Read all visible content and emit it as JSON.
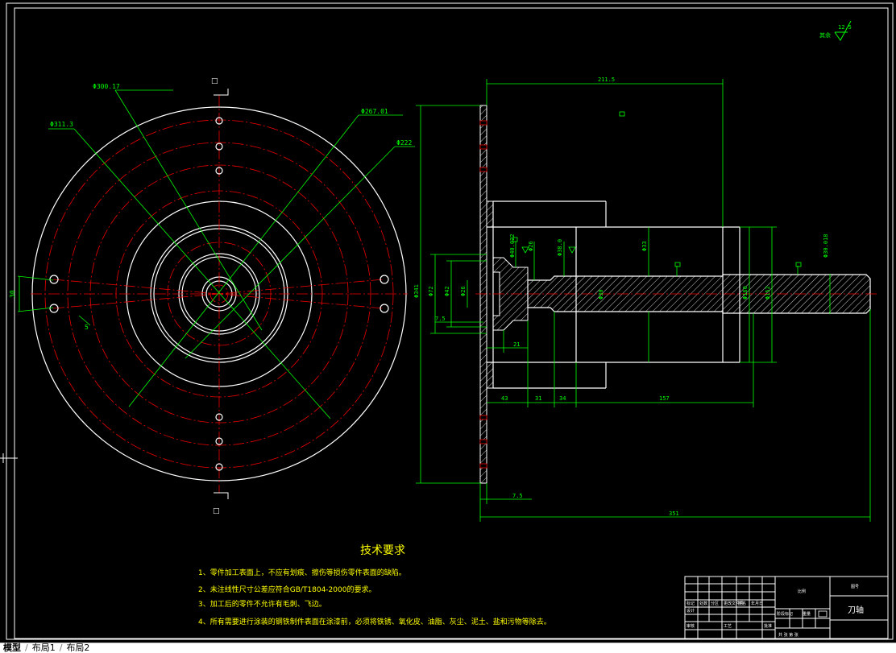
{
  "dims": {
    "d_311_3": "Φ311.3",
    "d_300_17": "Φ300.17",
    "d_267_01": "Φ267.01",
    "d_222": "Φ222",
    "d_341": "Φ341",
    "d_72": "Φ72",
    "d_42": "Φ42",
    "d_26": "Φ26",
    "d_40_022": "Φ40.022",
    "d_38_0": "Φ38.0",
    "d_33": "Φ33",
    "d_160": "Φ160",
    "d_152": "Φ152",
    "d_30_018": "Φ30.018",
    "d_shaft": "Φ30",
    "len_211_5": "211.5",
    "len_7_5a": "7.5",
    "len_7_5b": "7.5",
    "len_21": "21",
    "len_43": "43",
    "len_31": "31",
    "len_34": "34",
    "len_157": "157",
    "len_351": "351",
    "len_30": "30",
    "len_5": "5"
  },
  "section_marks": {
    "top": "□",
    "bottom": "□",
    "right": "□"
  },
  "roughness": {
    "label": "其余",
    "value": "12.5"
  },
  "tech_req": {
    "title": "技术要求",
    "items": [
      "1、零件加工表面上，不应有划痕、擦伤等损伤零件表面的缺陷。",
      "2、未注线性尺寸公差应符合GB/T1804-2000的要求。",
      "3、加工后的零件不允许有毛刺、飞边。",
      "4、所有需要进行涂装的钢铁制件表面在涂漆前，必须将铁锈、氧化皮、油脂、灰尘、泥土、盐和污物等除去。"
    ]
  },
  "title_block": {
    "material_label": "比例",
    "top_right_label": "图号",
    "part_name": "刀轴",
    "cell_a": "标记",
    "cell_b": "设计",
    "cell_c": "审核",
    "cell_d": "工艺",
    "cell_e": "重量",
    "cell_f": "共 张 第 张",
    "cell_g": "批准",
    "cell_h": "阶段标记",
    "cell_i": "处数",
    "cell_j": "分区",
    "cell_k": "更改文件号",
    "cell_l": "签名",
    "cell_m": "年月日"
  },
  "tabs": [
    "模型",
    "布局1",
    "布局2"
  ]
}
